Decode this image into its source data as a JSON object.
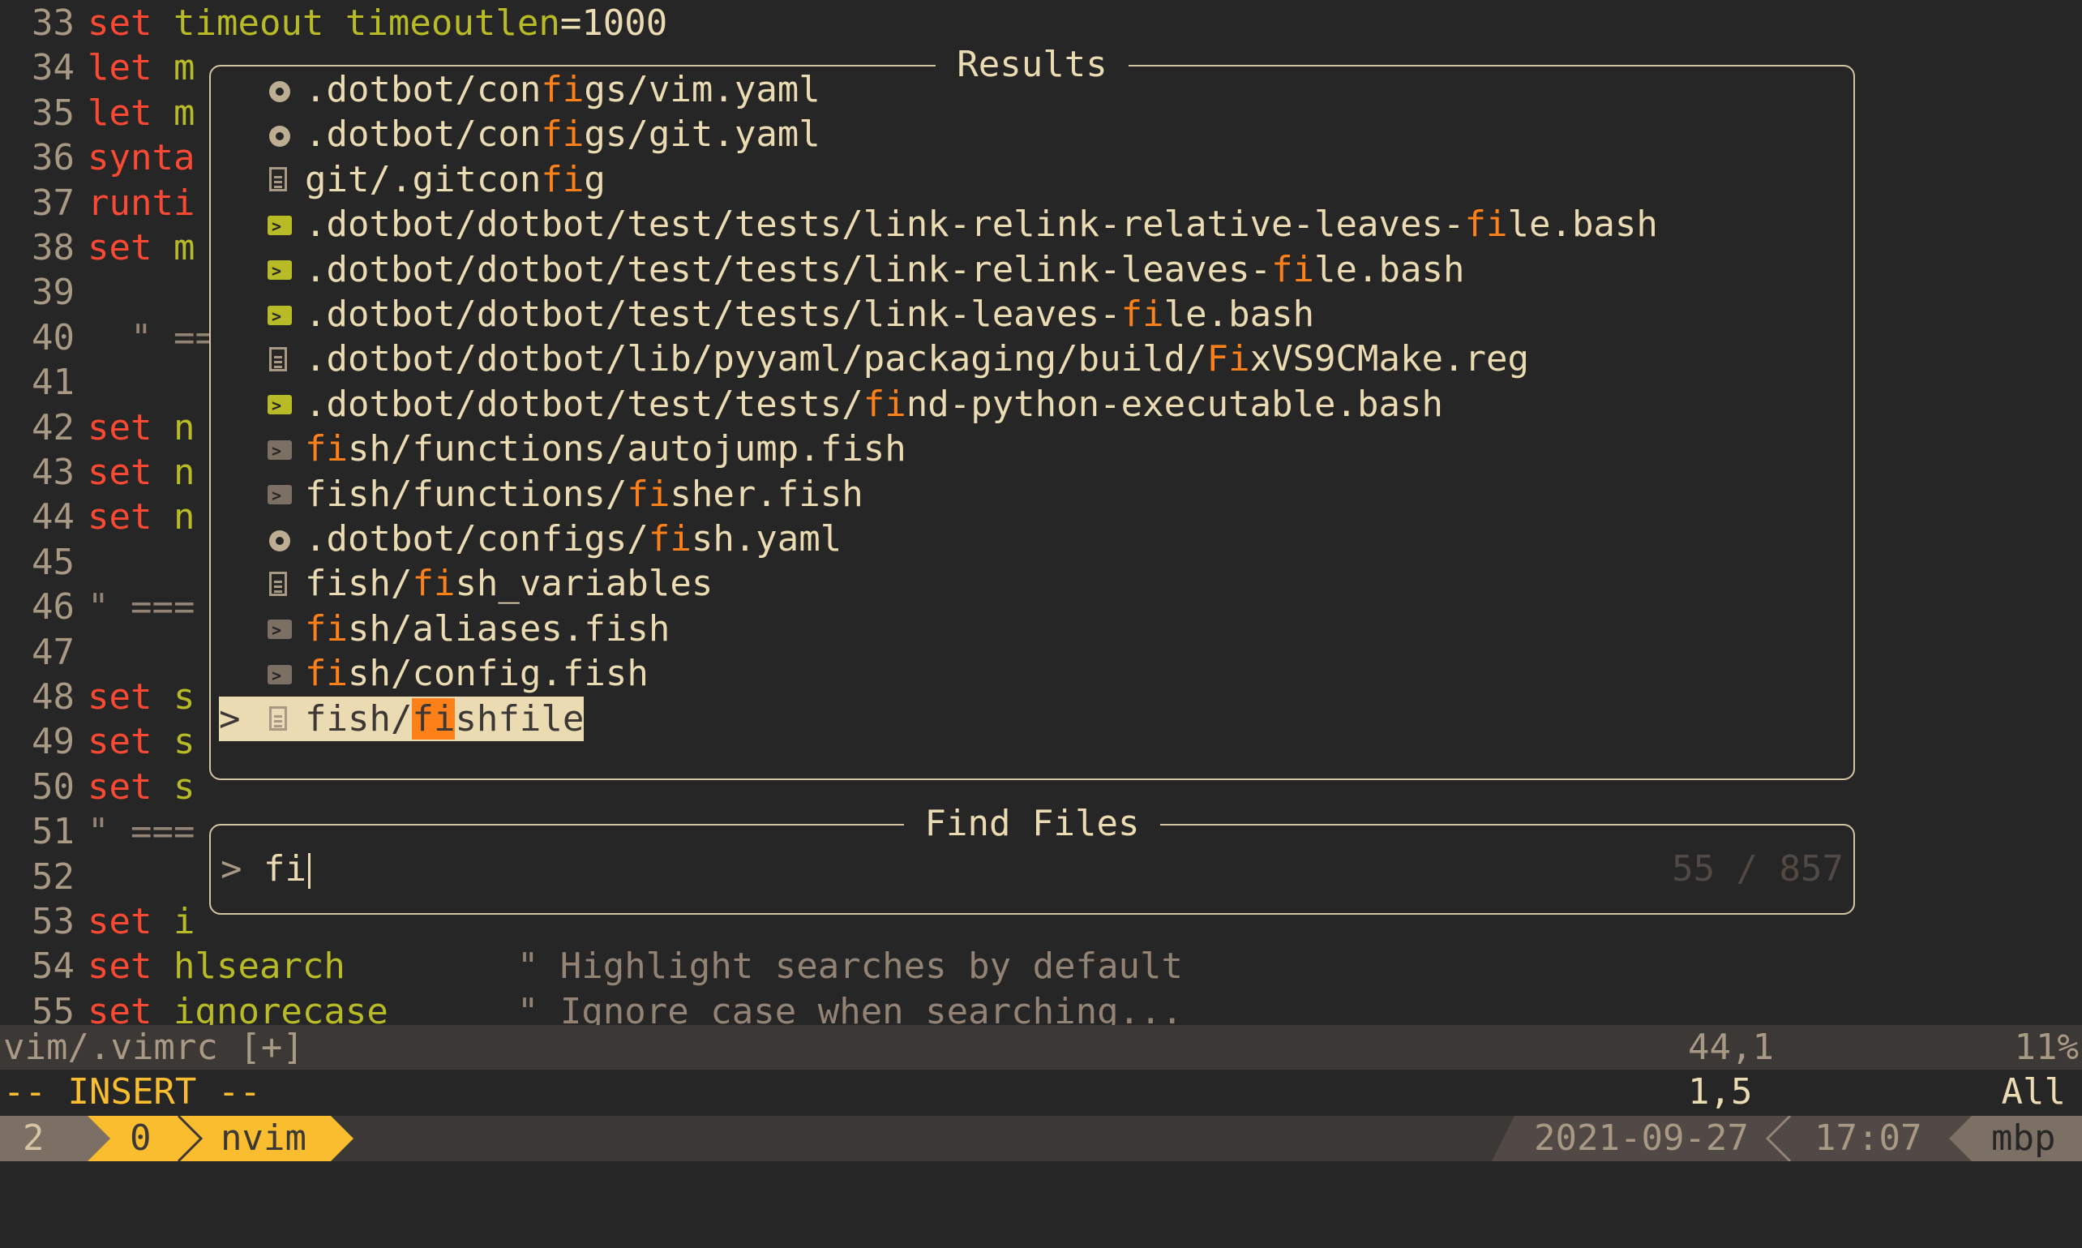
{
  "editor": {
    "lines": [
      {
        "num": "33",
        "parts": [
          {
            "t": "set",
            "c": "kw"
          },
          {
            "t": " ",
            "c": "op"
          },
          {
            "t": "timeout",
            "c": "id"
          },
          {
            "t": " ",
            "c": "op"
          },
          {
            "t": "timeoutlen",
            "c": "id"
          },
          {
            "t": "=1000",
            "c": "op"
          }
        ]
      },
      {
        "num": "34",
        "parts": [
          {
            "t": "let",
            "c": "kw"
          },
          {
            "t": " m",
            "c": "id"
          }
        ]
      },
      {
        "num": "35",
        "parts": [
          {
            "t": "let",
            "c": "kw"
          },
          {
            "t": " m",
            "c": "id"
          }
        ]
      },
      {
        "num": "36",
        "parts": [
          {
            "t": "synta",
            "c": "kw"
          }
        ]
      },
      {
        "num": "37",
        "parts": [
          {
            "t": "runti",
            "c": "kw"
          }
        ]
      },
      {
        "num": "38",
        "parts": [
          {
            "t": "set",
            "c": "kw"
          },
          {
            "t": " m",
            "c": "id"
          }
        ]
      },
      {
        "num": "39",
        "parts": []
      },
      {
        "num": "40",
        "parts": [
          {
            "t": "  \" ==",
            "c": "cm"
          }
        ]
      },
      {
        "num": "41",
        "parts": []
      },
      {
        "num": "42",
        "parts": [
          {
            "t": "set",
            "c": "kw"
          },
          {
            "t": " n",
            "c": "id"
          }
        ]
      },
      {
        "num": "43",
        "parts": [
          {
            "t": "set",
            "c": "kw"
          },
          {
            "t": " n",
            "c": "id"
          }
        ]
      },
      {
        "num": "44",
        "parts": [
          {
            "t": "set",
            "c": "kw"
          },
          {
            "t": " n",
            "c": "id"
          }
        ]
      },
      {
        "num": "45",
        "parts": []
      },
      {
        "num": "46",
        "parts": [
          {
            "t": "\" ===",
            "c": "cm"
          }
        ]
      },
      {
        "num": "47",
        "parts": []
      },
      {
        "num": "48",
        "parts": [
          {
            "t": "set",
            "c": "kw"
          },
          {
            "t": " s",
            "c": "id"
          }
        ]
      },
      {
        "num": "49",
        "parts": [
          {
            "t": "set",
            "c": "kw"
          },
          {
            "t": " s",
            "c": "id"
          }
        ]
      },
      {
        "num": "50",
        "parts": [
          {
            "t": "set",
            "c": "kw"
          },
          {
            "t": " s",
            "c": "id"
          }
        ]
      },
      {
        "num": "51",
        "parts": [
          {
            "t": "\" ===",
            "c": "cm"
          }
        ]
      },
      {
        "num": "52",
        "parts": []
      },
      {
        "num": "53",
        "parts": [
          {
            "t": "set",
            "c": "kw"
          },
          {
            "t": " i",
            "c": "id"
          }
        ]
      },
      {
        "num": "54",
        "parts": [
          {
            "t": "set",
            "c": "kw"
          },
          {
            "t": " ",
            "c": "op"
          },
          {
            "t": "hlsearch",
            "c": "id"
          },
          {
            "t": "        ",
            "c": "op"
          },
          {
            "t": "\" Highlight searches by default",
            "c": "cm"
          }
        ]
      },
      {
        "num": "55",
        "parts": [
          {
            "t": "set",
            "c": "kw"
          },
          {
            "t": " ",
            "c": "op"
          },
          {
            "t": "ignorecase",
            "c": "id"
          },
          {
            "t": "      ",
            "c": "op"
          },
          {
            "t": "\" Ignore case when searching...",
            "c": "cm"
          }
        ]
      }
    ]
  },
  "results": {
    "title": "Results",
    "selected_index": 14,
    "items": [
      {
        "icon": "gear-icon",
        "pre": ".dotbot/con",
        "match": "fi",
        "post": "gs/vim.yaml"
      },
      {
        "icon": "gear-icon",
        "pre": ".dotbot/con",
        "match": "fi",
        "post": "gs/git.yaml"
      },
      {
        "icon": "file-icon",
        "pre": "git/.gitcon",
        "match": "fi",
        "post": "g"
      },
      {
        "icon": "terminal-icon",
        "pre": ".dotbot/dotbot/test/tests/link-relink-relative-leaves-",
        "match": "fi",
        "post": "le.bash"
      },
      {
        "icon": "terminal-icon",
        "pre": ".dotbot/dotbot/test/tests/link-relink-leaves-",
        "match": "fi",
        "post": "le.bash"
      },
      {
        "icon": "terminal-icon",
        "pre": ".dotbot/dotbot/test/tests/link-leaves-",
        "match": "fi",
        "post": "le.bash"
      },
      {
        "icon": "file-icon",
        "pre": ".dotbot/dotbot/lib/pyyaml/packaging/build/",
        "match": "Fi",
        "post": "xVS9CMake.reg"
      },
      {
        "icon": "terminal-icon",
        "pre": ".dotbot/dotbot/test/tests/",
        "match": "fi",
        "post": "nd-python-executable.bash"
      },
      {
        "icon": "fish-icon",
        "pre": "",
        "match": "fi",
        "post": "sh/functions/autojump.fish"
      },
      {
        "icon": "fish-icon",
        "pre": "fish/functions/",
        "match": "fi",
        "post": "sher.fish"
      },
      {
        "icon": "gear-icon",
        "pre": ".dotbot/configs/",
        "match": "fi",
        "post": "sh.yaml"
      },
      {
        "icon": "file-icon",
        "pre": "fish/",
        "match": "fi",
        "post": "sh_variables"
      },
      {
        "icon": "fish-icon",
        "pre": "",
        "match": "fi",
        "post": "sh/aliases.fish"
      },
      {
        "icon": "fish-icon",
        "pre": "",
        "match": "fi",
        "post": "sh/config.fish"
      },
      {
        "icon": "file-icon",
        "pre": "fish/",
        "match": "fi",
        "post": "shfile"
      }
    ]
  },
  "finder": {
    "title": "Find Files",
    "prompt": ">",
    "query": "fi",
    "counter": "55 / 857"
  },
  "statusline": {
    "filename": "vim/.vimrc [+]",
    "position": "44,1",
    "percent": "11%"
  },
  "modeline": {
    "mode": "-- INSERT --",
    "position": "1,5",
    "scroll": "All"
  },
  "tmux": {
    "session": "2",
    "window_index": "0",
    "window_name": "nvim",
    "date": "2021-09-27",
    "time": "17:07",
    "host": "mbp"
  },
  "colors": {
    "background": "#262626",
    "keyword": "#fb4934",
    "identifier": "#b8bb26",
    "match": "#fe8019",
    "accent": "#fabd2f"
  }
}
